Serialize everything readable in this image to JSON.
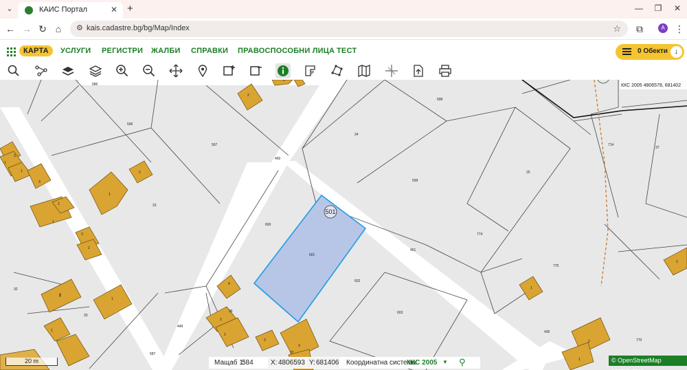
{
  "browser": {
    "tab_title": "КАИС Портал",
    "url": "kais.cadastre.bg/bg/Map/Index",
    "profile_initial": "A"
  },
  "nav": {
    "items": [
      "КАРТА",
      "УСЛУГИ",
      "РЕГИСТРИ",
      "ЖАЛБИ",
      "СПРАВКИ",
      "ПРАВОСПОСОБНИ ЛИЦА",
      "ТЕСТ"
    ],
    "objects_label": "0 Обекти"
  },
  "toolbar": {
    "tools": [
      "search-icon",
      "route-icon",
      "layers-icon",
      "layers-outline-icon",
      "zoom-in-icon",
      "zoom-out-icon",
      "pan-icon",
      "location-pin-icon",
      "select-area-plus-icon",
      "select-area-minus-icon",
      "info-icon",
      "measure-length-icon",
      "measure-polygon-icon",
      "map-icon",
      "crosshair-icon",
      "export-icon",
      "print-icon"
    ]
  },
  "map": {
    "coords_label": "ККС 2005 4806578, 681402",
    "selected_parcel_badge": "501",
    "parcel_labels": [
      "586",
      "596",
      "597",
      "24",
      "598",
      "599",
      "25",
      "714",
      "37",
      "23",
      "600",
      "601",
      "602",
      "603",
      "774",
      "775",
      "770",
      "451",
      "450",
      "449",
      "436",
      "33",
      "32",
      "587",
      "26",
      "37",
      "2",
      "3",
      "1",
      "2",
      "4",
      "1",
      "3",
      "2",
      "1",
      "2",
      "3",
      "1",
      "4",
      "1",
      "2",
      "3",
      "3",
      "4",
      "1",
      "1",
      "2",
      "1",
      "2",
      "3",
      "1"
    ],
    "scale_label": "20 m",
    "attribution": "© OpenStreetMap contributors."
  },
  "status": {
    "scale_label": "Мащаб 1:",
    "scale_value": "584",
    "x_label": "X:",
    "x_value": "4806593",
    "y_label": "Y:",
    "y_value": "681406",
    "system_label": "Координатна система:",
    "system_value": "ККС 2005"
  },
  "colors": {
    "brand_green": "#1b7f26",
    "accent_yellow": "#f5c431",
    "building": "#d9a431",
    "selected_fill": "#b7c5e6",
    "selected_stroke": "#1e9be8"
  }
}
